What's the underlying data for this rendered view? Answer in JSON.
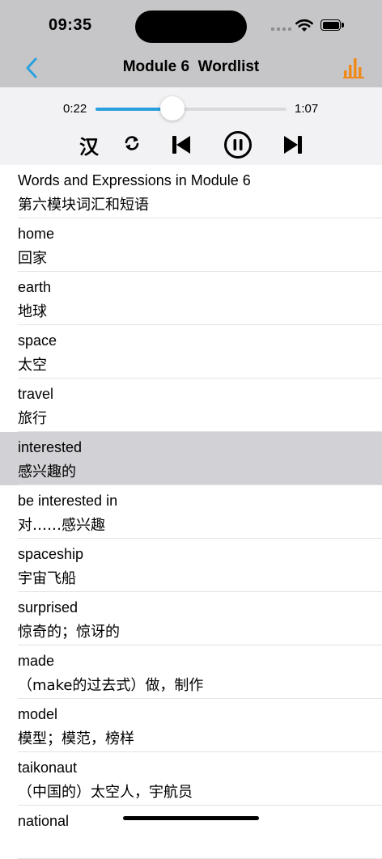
{
  "status_bar": {
    "time": "09:35"
  },
  "nav": {
    "title": "Module 6  Wordlist",
    "back_icon": "chevron-left-icon",
    "chart_icon": "bar-chart-icon",
    "accent_color": "#2aa0df",
    "chart_color": "#f08a1a"
  },
  "player": {
    "current_time": "0:22",
    "total_time": "1:07",
    "progress": 0.35,
    "lang_toggle_label": "汉",
    "controls": [
      "repeat-icon",
      "previous-icon",
      "pause-icon",
      "next-icon"
    ]
  },
  "words": [
    {
      "en": "Words and Expressions in Module 6",
      "zh": "第六模块词汇和短语"
    },
    {
      "en": "home",
      "zh": "回家"
    },
    {
      "en": "earth",
      "zh": "地球"
    },
    {
      "en": "space",
      "zh": "太空"
    },
    {
      "en": "travel",
      "zh": "旅行"
    },
    {
      "en": "interested",
      "zh": "感兴趣的"
    },
    {
      "en": "be interested in",
      "zh": "对……感兴趣"
    },
    {
      "en": "spaceship",
      "zh": "宇宙飞船"
    },
    {
      "en": "surprised",
      "zh": "惊奇的；惊讶的"
    },
    {
      "en": "made",
      "zh": "（make的过去式）做，制作"
    },
    {
      "en": "model",
      "zh": "模型；模范，榜样"
    },
    {
      "en": "taikonaut",
      "zh": "（中国的）太空人，宇航员"
    },
    {
      "en": "national",
      "zh": ""
    }
  ],
  "selected_index": 5
}
